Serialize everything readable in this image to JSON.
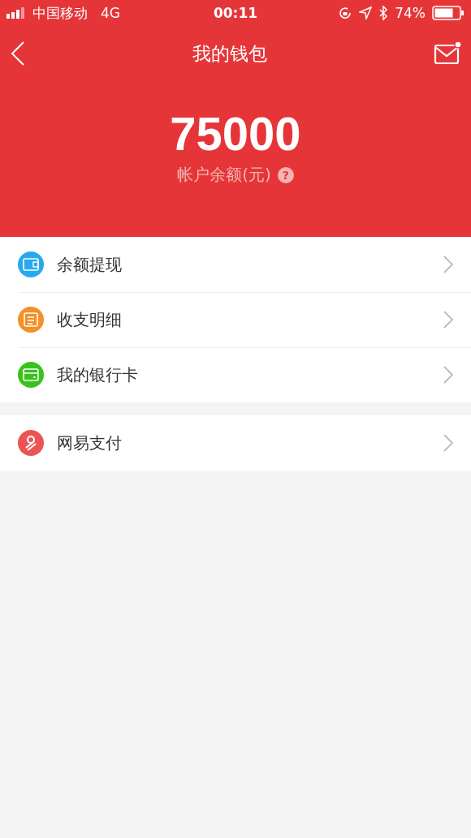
{
  "status_bar": {
    "carrier": "中国移动",
    "network": "4G",
    "time": "00:11",
    "battery": "74%"
  },
  "nav": {
    "title": "我的钱包"
  },
  "balance": {
    "amount": "75000",
    "label": "帐户余额(元)",
    "help": "?"
  },
  "groups": [
    {
      "items": [
        {
          "label": "余额提现",
          "kind": "wallet",
          "color": "#2aa8ee"
        },
        {
          "label": "收支明细",
          "kind": "list",
          "color": "#f39027"
        },
        {
          "label": "我的银行卡",
          "kind": "card",
          "color": "#38c21d"
        }
      ]
    },
    {
      "items": [
        {
          "label": "网易支付",
          "kind": "pay",
          "color": "#ec5454"
        }
      ]
    }
  ]
}
